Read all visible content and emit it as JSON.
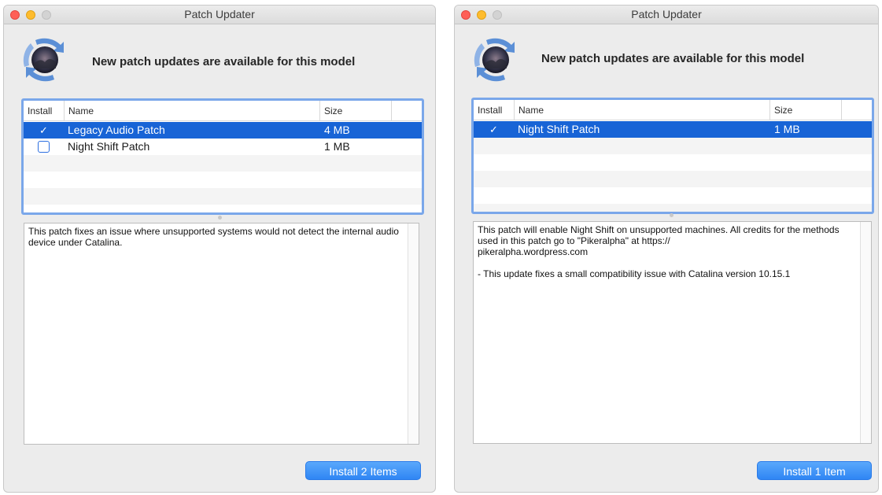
{
  "windows": [
    {
      "title": "Patch Updater",
      "headline": "New patch updates are available for this model",
      "columns": {
        "install": "Install",
        "name": "Name",
        "size": "Size"
      },
      "rows": [
        {
          "checked": true,
          "check_glyph": "✓",
          "name": "Legacy Audio Patch",
          "size": "4 MB",
          "selected": true
        },
        {
          "checked": false,
          "check_glyph": "",
          "name": "Night Shift Patch",
          "size": "1 MB",
          "selected": false
        }
      ],
      "description": "This patch fixes an issue where unsupported systems would not detect the internal audio device under Catalina.",
      "install_button": "Install 2 Items"
    },
    {
      "title": "Patch Updater",
      "headline": "New patch updates are available for this model",
      "columns": {
        "install": "Install",
        "name": "Name",
        "size": "Size"
      },
      "rows": [
        {
          "checked": true,
          "check_glyph": "✓",
          "name": "Night Shift Patch",
          "size": "1 MB",
          "selected": true
        }
      ],
      "description": "This patch will enable Night Shift on unsupported machines. All credits for the methods used in this patch go to \"Pikeralpha\" at https://\npikeralpha.wordpress.com\n\n- This update fixes a small compatibility issue with Catalina version 10.15.1",
      "install_button": "Install 1 Item"
    }
  ],
  "colors": {
    "selection": "#1864d6",
    "table_focus_ring": "#7aa7ea",
    "button": "#2f86f4",
    "close": "#fe5f57",
    "minimize": "#febc2e"
  },
  "icons": [
    "update-arrows-icon",
    "checkmark-icon"
  ]
}
